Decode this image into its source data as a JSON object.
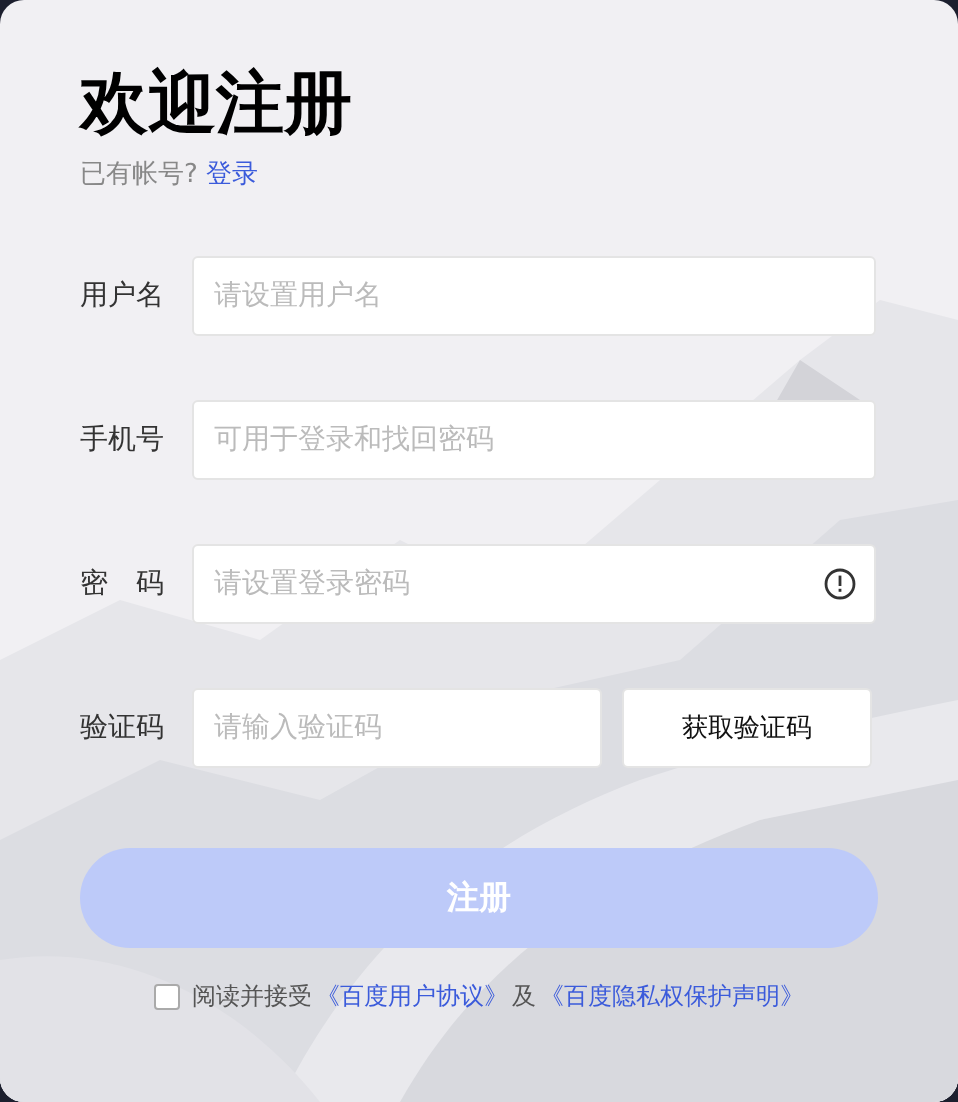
{
  "title": "欢迎注册",
  "subtitle": {
    "text": "已有帐号?",
    "link": "登录"
  },
  "fields": [
    {
      "kind": "text",
      "label": "用户名",
      "placeholder": "请设置用户名"
    },
    {
      "kind": "text",
      "label": "手机号",
      "placeholder": "可用于登录和找回密码"
    },
    {
      "kind": "password",
      "label": "密　码",
      "placeholder": "请设置登录密码"
    },
    {
      "kind": "code",
      "label": "验证码",
      "placeholder": "请输入验证码",
      "button": "获取验证码"
    }
  ],
  "submit": {
    "label": "注册",
    "disabled": true
  },
  "agreement": {
    "checked": false,
    "text": "阅读并接受",
    "link_1": "《百度用户协议》",
    "joiner": "及",
    "link_2": "《百度隐私权保护声明》"
  }
}
